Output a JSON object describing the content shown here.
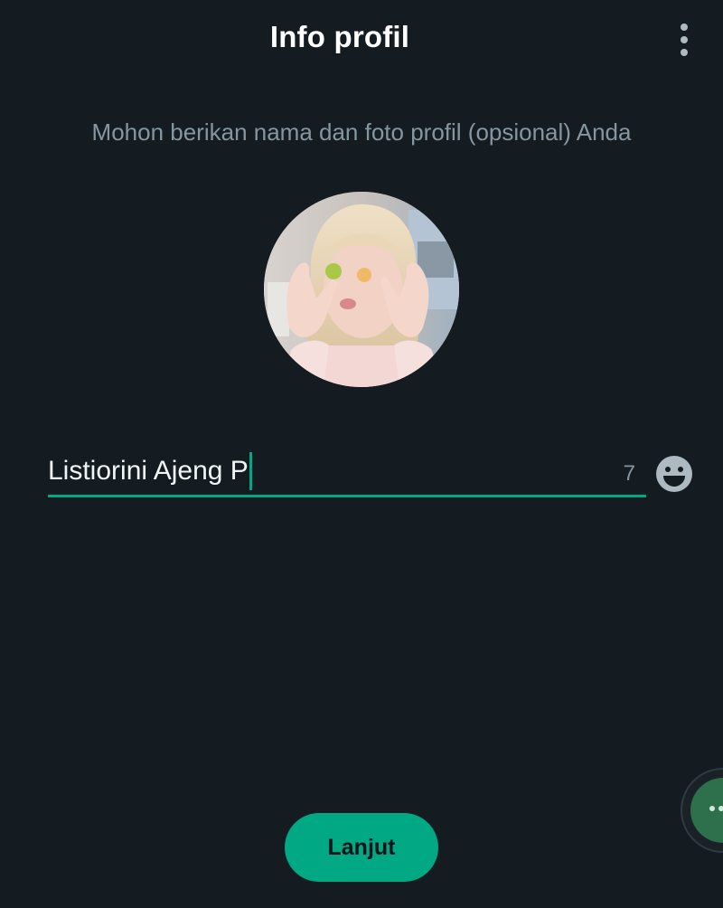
{
  "header": {
    "title": "Info profil",
    "menu_icon": "more-vert-icon"
  },
  "subtitle": "Mohon berikan nama dan foto profil (opsional) Anda",
  "profile": {
    "photo_icon": "profile-photo",
    "name_value": "Listiorini Ajeng P",
    "remaining_chars": "7",
    "emoji_icon": "emoji-icon"
  },
  "footer": {
    "next_label": "Lanjut"
  },
  "colors": {
    "background": "#141b21",
    "accent": "#00a884",
    "secondary_text": "#8696a0"
  }
}
